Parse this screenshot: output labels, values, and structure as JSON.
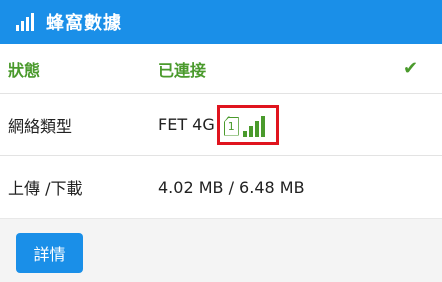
{
  "header": {
    "title": "蜂窩數據",
    "icon": "signal-bars-icon"
  },
  "rows": {
    "status": {
      "label": "狀態",
      "value": "已連接",
      "icon": "check-icon"
    },
    "type": {
      "label": "網絡類型",
      "value": "FET 4G",
      "sim_slot": "1",
      "signal_level": 4,
      "signal_max": 4
    },
    "traffic": {
      "label": "上傳 /下載",
      "value": "4.02 MB / 6.48 MB"
    }
  },
  "footer": {
    "details_label": "詳情"
  },
  "colors": {
    "accent": "#1a8fe8",
    "connected": "#4a9a2c",
    "highlight": "#e0141e"
  }
}
